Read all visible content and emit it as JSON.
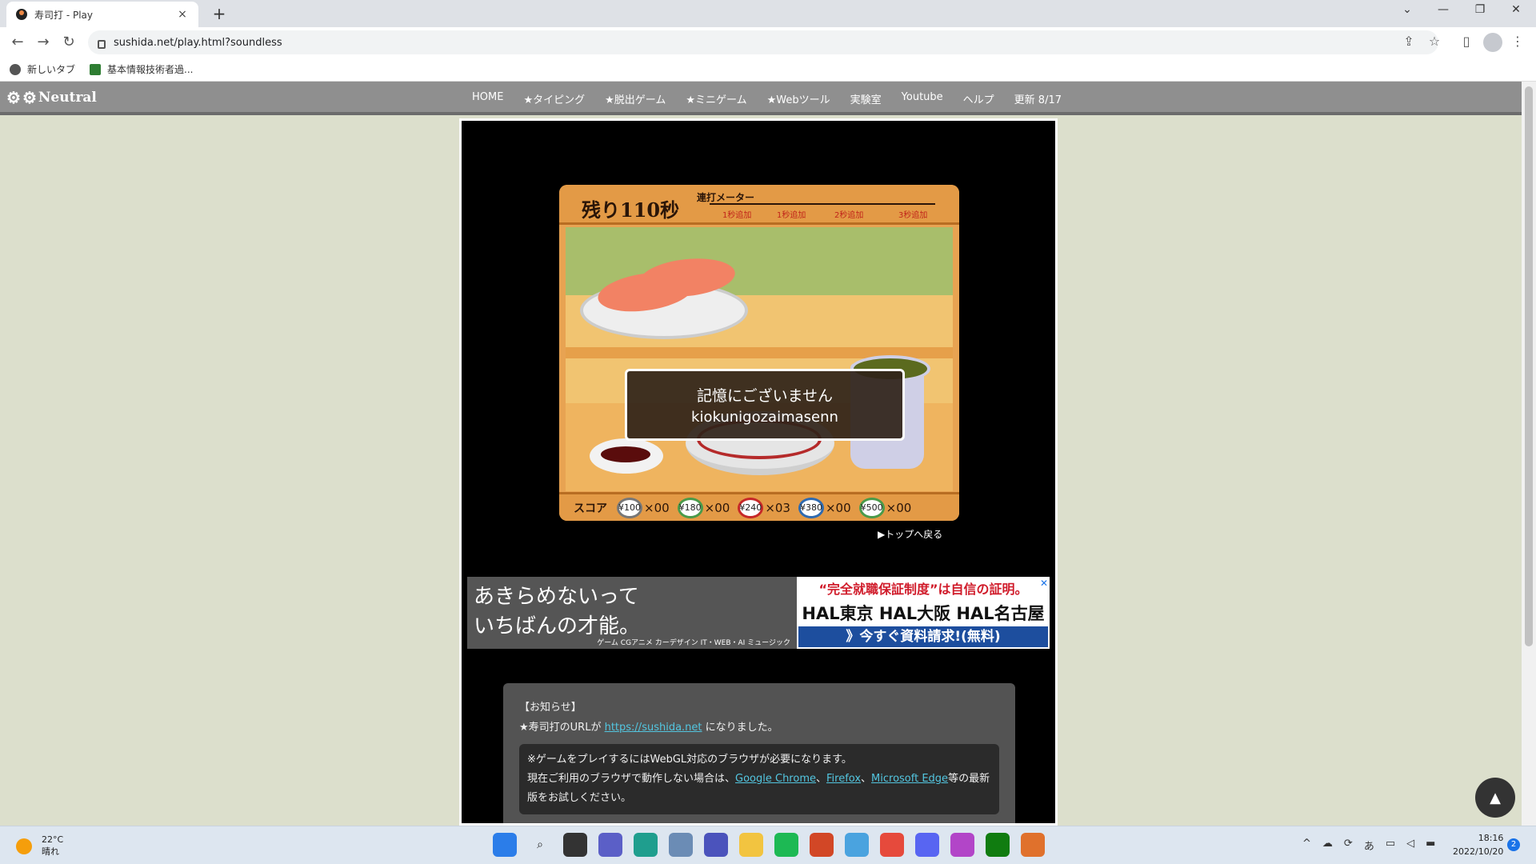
{
  "browser": {
    "tab_title": "寿司打 - Play",
    "close_glyph": "×",
    "new_tab_glyph": "+",
    "url": "sushida.net/play.html?soundless",
    "bookmarks": [
      {
        "label": "新しいタブ"
      },
      {
        "label": "基本情報技術者過..."
      }
    ]
  },
  "site": {
    "logo": "Neutral",
    "nav": [
      "HOME",
      "★タイピング",
      "★脱出ゲーム",
      "★ミニゲーム",
      "★Webツール",
      "実験室",
      "Youtube",
      "ヘルプ",
      "更新 8/17"
    ]
  },
  "game": {
    "timer": "残り110秒",
    "meter_title": "連打メーター",
    "meter_labels": [
      "1秒追加",
      "1秒追加",
      "2秒追加",
      "3秒追加"
    ],
    "word_japanese": "記憶にございません",
    "word_romaji": "kiokunigozaimasenn",
    "score_label": "スコア",
    "plates": [
      {
        "price": "¥100",
        "count": "×00"
      },
      {
        "price": "¥180",
        "count": "×00"
      },
      {
        "price": "¥240",
        "count": "×03"
      },
      {
        "price": "¥380",
        "count": "×00"
      },
      {
        "price": "¥500",
        "count": "×00"
      }
    ],
    "back_link": "▶トップへ戻る"
  },
  "ad": {
    "left_line1": "あきらめないって",
    "left_line2": "いちばんの才能。",
    "left_sub": "ゲーム CGアニメ カーデザイン IT・WEB・AI ミュージック",
    "right_line1": "“完全就職保証制度”は自信の証明。",
    "right_line2": "HAL東京 HAL大阪 HAL名古屋",
    "right_cta": "》今すぐ資料請求!(無料)"
  },
  "notice": {
    "heading": "【お知らせ】",
    "url_prefix": "★寿司打のURLが",
    "url_link": "https://sushida.net",
    "url_suffix": "になりました。",
    "webgl_line1": "※ゲームをプレイするにはWebGL対応のブラウザが必要になります。",
    "webgl_line2_prefix": "現在ご利用のブラウザで動作しない場合は、",
    "link_chrome": "Google Chrome",
    "sep1": "、",
    "link_firefox": "Firefox",
    "sep2": "、",
    "link_edge": "Microsoft Edge",
    "webgl_line2_suffix": "等の最新",
    "webgl_line3": "版をお試しください。"
  },
  "taskbar": {
    "temperature": "22°C",
    "weather": "晴れ",
    "time": "18:16",
    "date": "2022/10/20",
    "notification_count": "2",
    "ime": "あ"
  }
}
